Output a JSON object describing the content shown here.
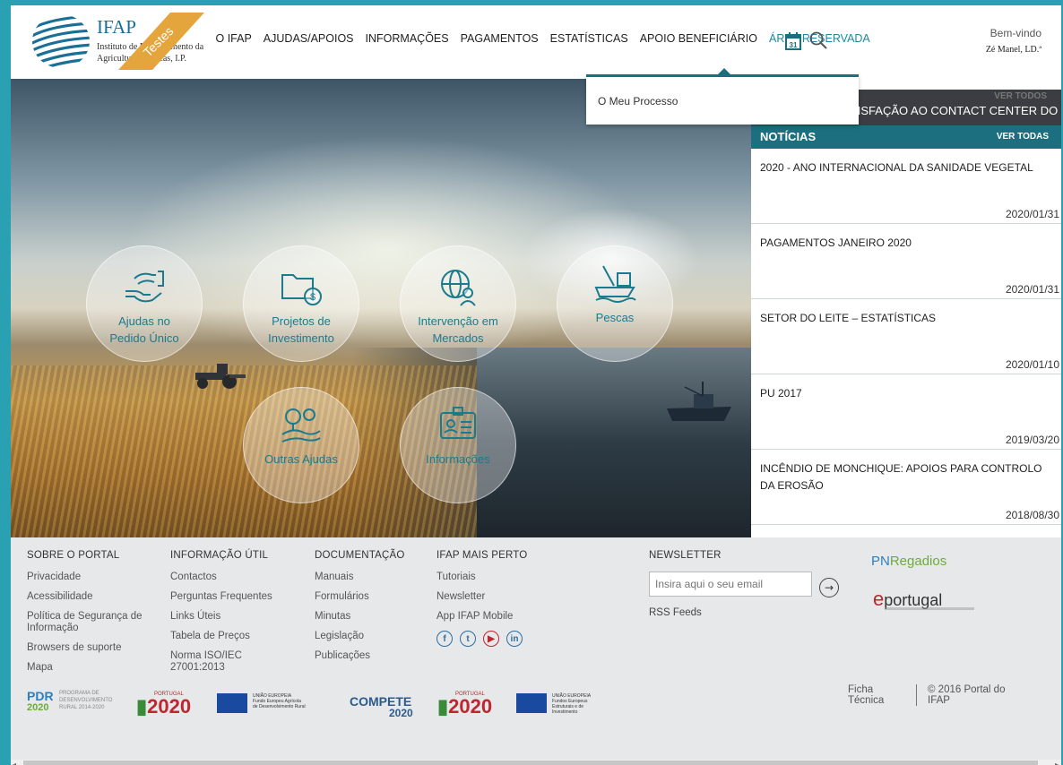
{
  "header": {
    "logo_title": "IFAP",
    "logo_subtitle": "Instituto de Financiamento da Agricultura e Pescas, I.P.",
    "ribbon_label": "Testes",
    "nav": [
      {
        "label": "O IFAP"
      },
      {
        "label": "AJUDAS/APOIOS"
      },
      {
        "label": "INFORMAÇÕES"
      },
      {
        "label": "PAGAMENTOS"
      },
      {
        "label": "ESTATÍSTICAS"
      },
      {
        "label": "APOIO BENEFICIÁRIO"
      },
      {
        "label": "ÁREA RESERVADA"
      }
    ],
    "calendar_day": "31",
    "welcome_label": "Bem-vindo",
    "welcome_user": "Zé Manel, LD.ª"
  },
  "dropdown": {
    "item": "O Meu Processo"
  },
  "hero": {
    "tiles": [
      {
        "label_1": "Ajudas no",
        "label_2": "Pedido Único"
      },
      {
        "label_1": "Projetos de",
        "label_2": "Investimento"
      },
      {
        "label_1": "Intervenção em",
        "label_2": "Mercados"
      },
      {
        "label_1": "Pescas"
      },
      {
        "label_1": "Outras Ajudas"
      },
      {
        "label_1": "Informações"
      }
    ]
  },
  "inquiry": {
    "see_all": "VER TODOS",
    "text": "...TISFAÇÃO AO CONTACT CENTER DO I..."
  },
  "news": {
    "title": "NOTÍCIAS",
    "see_all": "VER TODAS",
    "items": [
      {
        "title": "2020 - ANO INTERNACIONAL DA SANIDADE VEGETAL",
        "date": "2020/01/31"
      },
      {
        "title": "PAGAMENTOS JANEIRO 2020",
        "date": "2020/01/31"
      },
      {
        "title": "SETOR DO LEITE – ESTATÍSTICAS",
        "date": "2020/01/10"
      },
      {
        "title": "PU 2017",
        "date": "2019/03/20"
      },
      {
        "title": "INCÊNDIO DE MONCHIQUE: APOIOS PARA CONTROLO DA EROSÃO",
        "date": "2018/08/30"
      }
    ]
  },
  "footer": {
    "sobre": {
      "title": "SOBRE O PORTAL",
      "links": [
        "Privacidade",
        "Acessibilidade",
        "Política de Segurança de Informação",
        "Browsers de suporte",
        "Mapa"
      ]
    },
    "info": {
      "title": "INFORMAÇÃO ÚTIL",
      "links": [
        "Contactos",
        "Perguntas Frequentes",
        "Links Úteis",
        "Tabela de Preços",
        "Norma ISO/IEC 27001:2013"
      ]
    },
    "docs": {
      "title": "DOCUMENTAÇÃO",
      "links": [
        "Manuais",
        "Formulários",
        "Minutas",
        "Legislação",
        "Publicações"
      ]
    },
    "perto": {
      "title": "IFAP MAIS PERTO",
      "links": [
        "Tutoriais",
        "Newsletter",
        "App IFAP Mobile"
      ]
    },
    "newsletter": {
      "title": "NEWSLETTER",
      "placeholder": "Insira aqui o seu email",
      "rss": "RSS Feeds"
    },
    "pnr_logo": {
      "prefix": "PN",
      "suffix": "Regadios"
    },
    "eportugal_logo": {
      "letter": "e",
      "rest": "portugal"
    },
    "logos": {
      "pdr_top": "PDR",
      "pdr_year": "2020",
      "pdr_l1": "PROGRAMA DE",
      "pdr_l2": "DESENVOLVIMENTO",
      "pdr_l3": "RURAL 2014-2020",
      "portugal": "PORTUGAL",
      "p2020": "2020",
      "ue": "UNIÃO EUROPEIA",
      "ue_fund1": "Fundo Europeu Agrícola de Desenvolvimento Rural",
      "compete": "COMPETE",
      "compete_year": "2020",
      "ue_fund2": "Fundos Europeus Estruturais e de Investimento"
    },
    "ficha": "Ficha Técnica",
    "copyright": "© 2016 Portal do IFAP"
  },
  "colors": {
    "accent": "#1b6f7e",
    "link_active": "#1b8aa0",
    "border": "#2aa1b3"
  }
}
